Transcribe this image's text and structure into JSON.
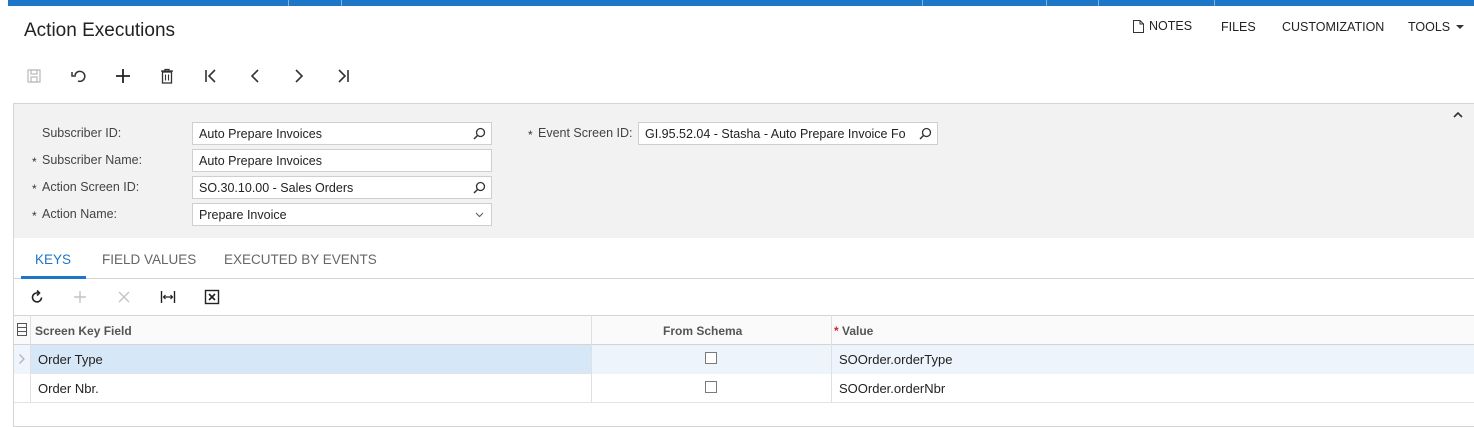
{
  "page": {
    "title": "Action Executions"
  },
  "header_menu": {
    "notes": "NOTES",
    "files": "FILES",
    "customization": "CUSTOMIZATION",
    "tools": "TOOLS"
  },
  "toolbar": {
    "icons": [
      "save-icon",
      "undo-icon",
      "add-icon",
      "delete-icon",
      "first-record-icon",
      "previous-record-icon",
      "next-record-icon",
      "last-record-icon"
    ]
  },
  "form": {
    "subscriber_id": {
      "label": "Subscriber ID:",
      "value": "Auto Prepare Invoices"
    },
    "subscriber_name": {
      "label": "Subscriber Name:",
      "value": "Auto Prepare Invoices",
      "required": "*"
    },
    "action_screen_id": {
      "label": "Action Screen ID:",
      "value": "SO.30.10.00 - Sales Orders",
      "required": "*"
    },
    "action_name": {
      "label": "Action Name:",
      "value": "Prepare Invoice",
      "required": "*"
    },
    "event_screen_id": {
      "label": "Event Screen ID:",
      "value": "GI.95.52.04 - Stasha - Auto Prepare Invoice Fo",
      "required": "*"
    }
  },
  "tabs": [
    {
      "label": "KEYS",
      "active": true
    },
    {
      "label": "FIELD VALUES",
      "active": false
    },
    {
      "label": "EXECUTED BY EVENTS",
      "active": false
    }
  ],
  "grid": {
    "toolbar_icons": [
      "refresh-icon",
      "add-row-icon",
      "delete-row-icon",
      "fit-columns-icon",
      "export-excel-icon"
    ],
    "columns": {
      "key_field": "Screen Key Field",
      "from_schema": "From Schema",
      "value": "Value",
      "value_required": "*"
    },
    "rows": [
      {
        "key_field": "Order Type",
        "from_schema": false,
        "value": "SOOrder.orderType",
        "selected": true
      },
      {
        "key_field": "Order Nbr.",
        "from_schema": false,
        "value": "SOOrder.orderNbr",
        "selected": false
      }
    ]
  },
  "colors": {
    "accent": "#1e76c8",
    "selected_row": "#d6e7f7",
    "form_bg": "#f2f2f2",
    "required_star": "#d9262b"
  }
}
